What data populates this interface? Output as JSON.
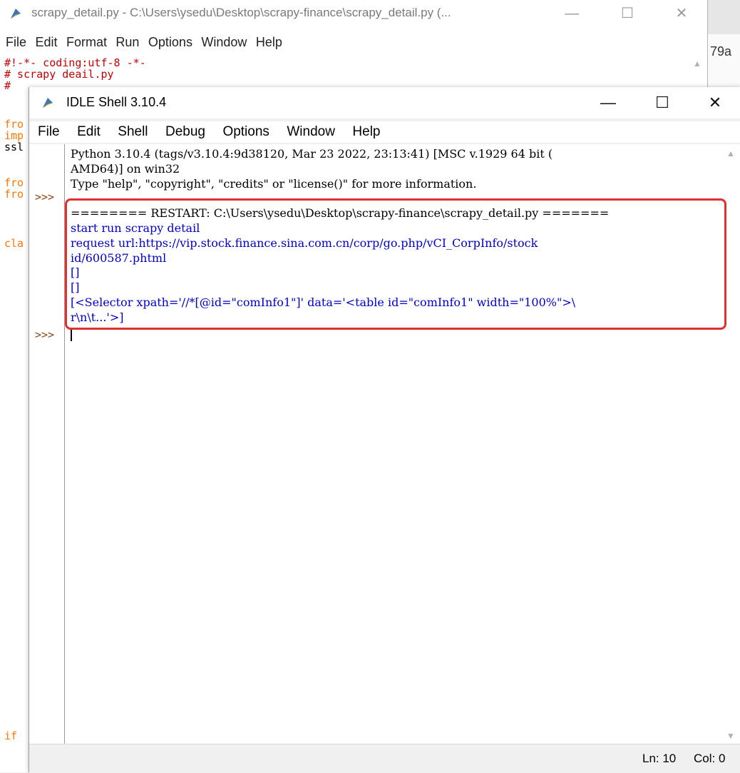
{
  "editor": {
    "title": "scrapy_detail.py - C:\\Users\\ysedu\\Desktop\\scrapy-finance\\scrapy_detail.py (...",
    "menu": [
      "File",
      "Edit",
      "Format",
      "Run",
      "Options",
      "Window",
      "Help"
    ],
    "controls": {
      "minimize": "—",
      "maximize": "☐",
      "close": "✕"
    },
    "code_lines": [
      "#!-*- coding:utf-8 -*-",
      "# scrapy deail.py",
      "#"
    ],
    "code_fragments": [
      "fro",
      "imp",
      "ssl",
      "fro",
      "fro",
      "cla",
      "if"
    ]
  },
  "background_window": {
    "fragment": "79a"
  },
  "shell": {
    "title": "IDLE Shell 3.10.4",
    "menu": [
      "File",
      "Edit",
      "Shell",
      "Debug",
      "Options",
      "Window",
      "Help"
    ],
    "controls": {
      "minimize": "—",
      "maximize": "☐",
      "close": "✕"
    },
    "prompt": ">>>",
    "banner": [
      "Python 3.10.4 (tags/v3.10.4:9d38120, Mar 23 2022, 23:13:41) [MSC v.1929 64 bit (",
      "AMD64)] on win32",
      "Type \"help\", \"copyright\", \"credits\" or \"license()\" for more information."
    ],
    "output": [
      "======== RESTART: C:\\Users\\ysedu\\Desktop\\scrapy-finance\\scrapy_detail.py =======",
      "start run scrapy detail",
      "request url:https://vip.stock.finance.sina.com.cn/corp/go.php/vCI_CorpInfo/stock",
      "id/600587.phtml",
      "[]",
      "[]",
      "[<Selector xpath='//*[@id=\"comInfo1\"]' data='<table id=\"comInfo1\" width=\"100%\">\\",
      "r\\n\\t...'>]"
    ],
    "status": {
      "line": "Ln: 10",
      "col": "Col: 0"
    }
  },
  "colors": {
    "output_blue": "#0000cc",
    "comment_red": "#c80000",
    "keyword_orange": "#ff7700",
    "highlight_box": "#e03030",
    "prompt_brown": "#8b4513"
  }
}
